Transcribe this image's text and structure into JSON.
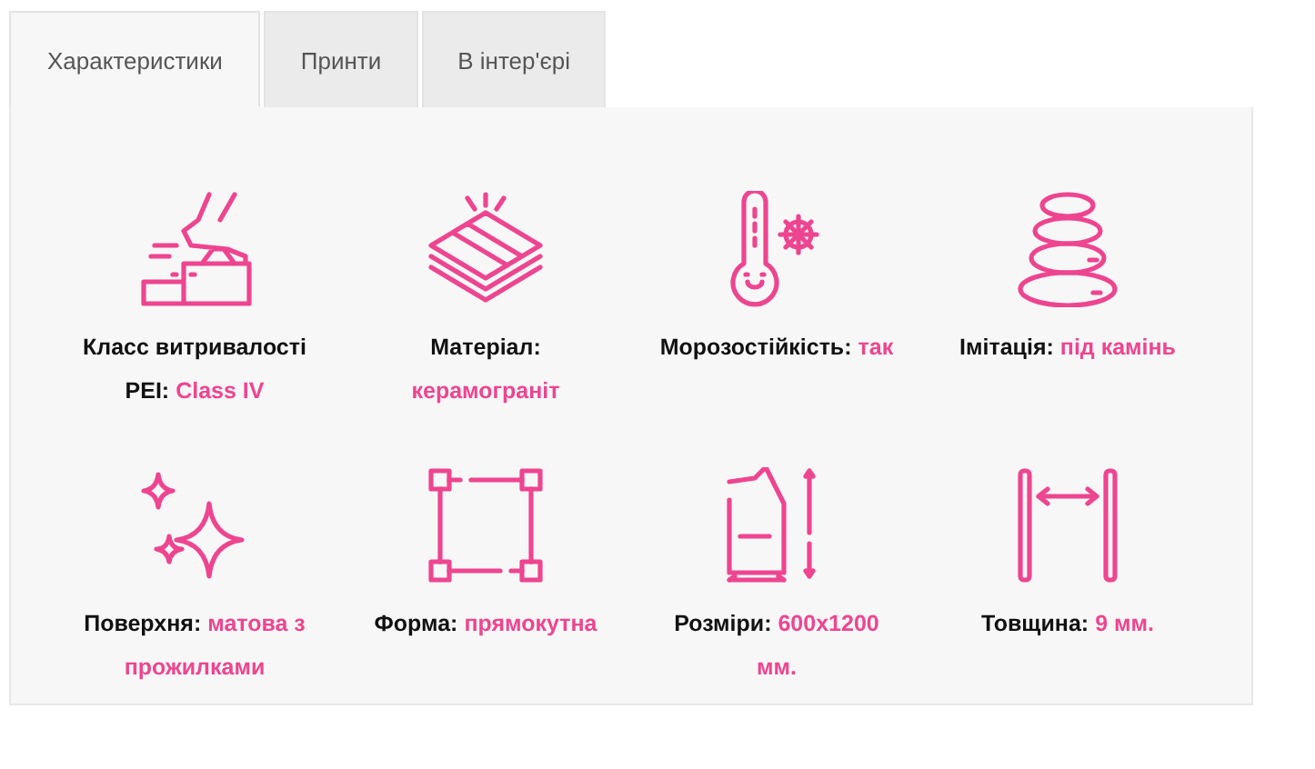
{
  "tabs": [
    {
      "label": "Характеристики",
      "selected": true
    },
    {
      "label": "Принти",
      "selected": false
    },
    {
      "label": "В інтер'єрі",
      "selected": false
    }
  ],
  "specs": [
    {
      "kind": "wear",
      "label": "Класс витривалості PEI:",
      "value": "Class IV"
    },
    {
      "kind": "material",
      "label": "Матеріал:",
      "value": "керамограніт"
    },
    {
      "kind": "frost",
      "label": "Морозостійкість:",
      "value": "так"
    },
    {
      "kind": "imitation",
      "label": "Імітація:",
      "value": "під камінь"
    },
    {
      "kind": "surface",
      "label": "Поверхня:",
      "value": "матова з прожилками"
    },
    {
      "kind": "shape",
      "label": "Форма:",
      "value": "прямокутна"
    },
    {
      "kind": "size",
      "label": "Розміри:",
      "value": "600x1200 мм."
    },
    {
      "kind": "thickness",
      "label": "Товщина:",
      "value": "9 мм."
    }
  ]
}
